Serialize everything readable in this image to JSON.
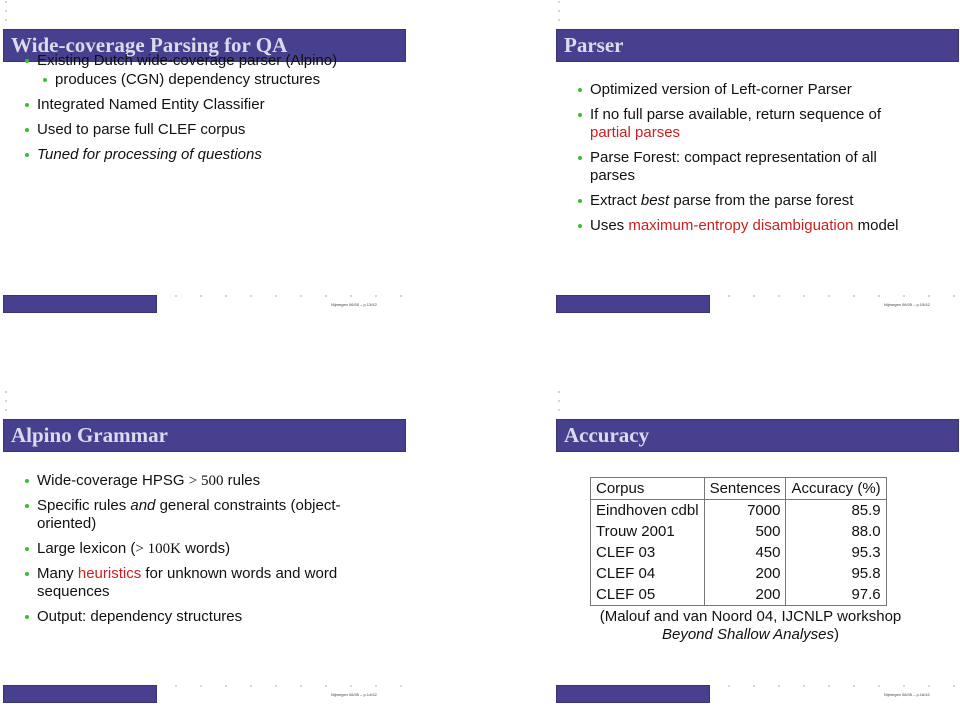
{
  "colors": {
    "title_bar": "#47408e",
    "title_text": "#dcdbee",
    "bullet": "#34c234",
    "highlight": "#cc1f1f"
  },
  "slides": [
    {
      "title": "Wide-coverage Parsing for QA",
      "footer": "Nijmegen 06/05 – p.13/42",
      "bullets": [
        {
          "level": 1,
          "text": "Existing Dutch wide-coverage parser (Alpino)"
        },
        {
          "level": 2,
          "text": "produces (CGN) dependency structures"
        },
        {
          "level": 1,
          "text": "Integrated Named Entity Classifier"
        },
        {
          "level": 1,
          "text": "Used to parse full CLEF corpus"
        },
        {
          "level": 1,
          "text": "Tuned for processing of questions",
          "style": "italic"
        }
      ]
    },
    {
      "title": "Parser",
      "footer": "Nijmegen 06/05 – p.15/42",
      "bullets": [
        {
          "text": "Optimized version of Left-corner Parser"
        },
        {
          "pre": "If no full parse available, return sequence of ",
          "highlight": "partial parses",
          "post": ""
        },
        {
          "text": "Parse Forest: compact representation of all parses"
        },
        {
          "pre": "Extract ",
          "emph": "best",
          "post": " parse from the parse forest"
        },
        {
          "pre": "Uses ",
          "highlight": "maximum-entropy disambiguation",
          "post": " model"
        }
      ]
    },
    {
      "title": "Alpino Grammar",
      "footer": "Nijmegen 06/05 – p.14/42",
      "bullets": [
        {
          "pre": "Wide-coverage HPSG ",
          "math": "> 500",
          "post": " rules"
        },
        {
          "pre": "Specific rules ",
          "emph": "and",
          "post": " general constraints (object-oriented)"
        },
        {
          "pre": "Large lexicon (",
          "math": "> 100K",
          "post": " words)"
        },
        {
          "pre": "Many ",
          "highlight": "heuristics",
          "post": " for unknown words and word sequences"
        },
        {
          "text": "Output: dependency structures"
        }
      ]
    },
    {
      "title": "Accuracy",
      "footer": "Nijmegen 06/05 – p.16/42",
      "table": {
        "headers": [
          "Corpus",
          "Sentences",
          "Accuracy (%)"
        ],
        "rows": [
          [
            "Eindhoven cdbl",
            "7000",
            "85.9"
          ],
          [
            "Trouw 2001",
            "500",
            "88.0"
          ],
          [
            "CLEF 03",
            "450",
            "95.3"
          ],
          [
            "CLEF 04",
            "200",
            "95.8"
          ],
          [
            "CLEF 05",
            "200",
            "97.6"
          ]
        ]
      },
      "citation": {
        "pre": "(Malouf and van Noord 04, IJCNLP workshop ",
        "emph": "Beyond Shallow Analyses",
        "post": ")"
      }
    }
  ]
}
